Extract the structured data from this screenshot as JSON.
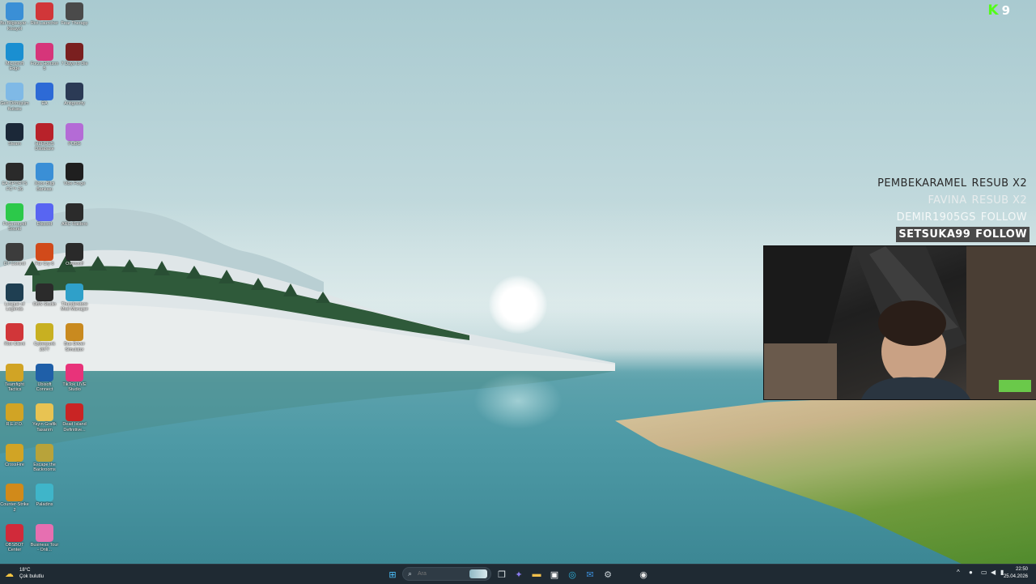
{
  "desktop_icons": [
    {
      "label": "Bu Bilgisayar - Kısayol",
      "icon": "computer-icon",
      "color": "#3a8fd6"
    },
    {
      "label": "Riot Launcher",
      "icon": "riot-icon",
      "color": "#d13639"
    },
    {
      "label": "Fear Therapy",
      "icon": "game-icon",
      "color": "#4a4a4a"
    },
    {
      "label": "Microsoft Edge",
      "icon": "edge-icon",
      "color": "#1a8fd1"
    },
    {
      "label": "Forza Horizon 5",
      "icon": "forza-icon",
      "color": "#d6357a"
    },
    {
      "label": "7 Days to Die",
      "icon": "game-icon",
      "color": "#7a1f1f"
    },
    {
      "label": "Geri Dönüşüm Kutusu",
      "icon": "recycle-bin-icon",
      "color": "#7fb9e6"
    },
    {
      "label": "EA",
      "icon": "ea-icon",
      "color": "#2d6ad6"
    },
    {
      "label": "Antigravity",
      "icon": "antigravity-icon",
      "color": "#2b3a55"
    },
    {
      "label": "Steam",
      "icon": "steam-icon",
      "color": "#1b2838"
    },
    {
      "label": "HEROES Database",
      "icon": "game-icon",
      "color": "#b8222a"
    },
    {
      "label": "PUBG",
      "icon": "pubg-icon",
      "color": "#b46bd6"
    },
    {
      "label": "EA SPORTS FC™ 26",
      "icon": "game-icon",
      "color": "#2a2a2a"
    },
    {
      "label": "Xbox Bilgi Bankası",
      "icon": "globe-icon",
      "color": "#3a8fd6"
    },
    {
      "label": "Vibe Forge",
      "icon": "forge-icon",
      "color": "#1f1f1f"
    },
    {
      "label": "FxSurround Sound",
      "icon": "sound-icon",
      "color": "#2cc94a"
    },
    {
      "label": "Discord",
      "icon": "discord-icon",
      "color": "#5865f2"
    },
    {
      "label": "ARC Raiders",
      "icon": "game-icon",
      "color": "#2b2b2b"
    },
    {
      "label": "DT Control",
      "icon": "control-icon",
      "color": "#3c3c3c"
    },
    {
      "label": "Far Cry 6",
      "icon": "farcry-icon",
      "color": "#d14a1a"
    },
    {
      "label": "Overwolf",
      "icon": "overwolf-icon",
      "color": "#2a2a2a"
    },
    {
      "label": "League of Legends",
      "icon": "lol-icon",
      "color": "#1f3f52"
    },
    {
      "label": "OBS Studio",
      "icon": "obs-icon",
      "color": "#2b2b2b"
    },
    {
      "label": "Thunderstore Mod Manager",
      "icon": "mod-icon",
      "color": "#2fa0c9"
    },
    {
      "label": "Riot Client",
      "icon": "riot-icon",
      "color": "#d13639"
    },
    {
      "label": "Cyberpunk 2077",
      "icon": "game-icon",
      "color": "#c8b021"
    },
    {
      "label": "Bus Driver Simulator",
      "icon": "game-icon",
      "color": "#c98a1f"
    },
    {
      "label": "Teamfight Tactics",
      "icon": "tft-icon",
      "color": "#d1a425"
    },
    {
      "label": "Ubisoft Connect",
      "icon": "ubisoft-icon",
      "color": "#1f5fa8"
    },
    {
      "label": "TikTok LIVE Studio",
      "icon": "tiktok-icon",
      "color": "#e8337a"
    },
    {
      "label": "R.E.P.O.",
      "icon": "game-icon",
      "color": "#d1a425"
    },
    {
      "label": "Yayın Grafik Tasarım",
      "icon": "folder-icon",
      "color": "#e8c352"
    },
    {
      "label": "Dead Island Definitive...",
      "icon": "game-icon",
      "color": "#c92424"
    },
    {
      "label": "CrossFire",
      "icon": "crossfire-icon",
      "color": "#d1a425"
    },
    {
      "label": "Escape the Backrooms",
      "icon": "game-icon",
      "color": "#b8a33a"
    },
    {
      "label": "",
      "icon": "",
      "color": ""
    },
    {
      "label": "Counter-Strike 2",
      "icon": "cs2-icon",
      "color": "#d18a1a"
    },
    {
      "label": "Paladins",
      "icon": "paladins-icon",
      "color": "#3fb5c9"
    },
    {
      "label": "",
      "icon": "",
      "color": ""
    },
    {
      "label": "OBSBOT Center",
      "icon": "obsbot-icon",
      "color": "#d12a3a"
    },
    {
      "label": "Business Tour - Onli...",
      "icon": "game-icon",
      "color": "#e66fb1"
    },
    {
      "label": "",
      "icon": "",
      "color": ""
    }
  ],
  "stream_overlay": {
    "kick": {
      "glyph": "K",
      "count": "9",
      "brand_color": "#53fc18"
    },
    "events": [
      {
        "user": "PEMBEKARAMEL",
        "action": "RESUB X2",
        "text_color": "#2a2a2a",
        "bg": "transparent"
      },
      {
        "user": "FAVINA",
        "action": "RESUB X2",
        "text_color": "#e7eced",
        "bg": "transparent"
      },
      {
        "user": "DEMIR1905GS",
        "action": "FOLLOW",
        "text_color": "#f4f8f8",
        "bg": "transparent"
      },
      {
        "user": "SETSUKA99",
        "action": "FOLLOW",
        "text_color": "#ffffff",
        "bg": "#4a4a4a"
      }
    ]
  },
  "taskbar": {
    "weather": {
      "temp": "18°C",
      "desc": "Çok bulutlu"
    },
    "search_placeholder": "Ara",
    "pinned": [
      {
        "icon": "windows-start-icon",
        "glyph": "⊞",
        "color": "#4cc2ff"
      },
      {
        "icon": "task-view-icon",
        "glyph": "❐",
        "color": "#dfe6ea"
      },
      {
        "icon": "copilot-icon",
        "glyph": "✦",
        "color": "#8a7cf0"
      },
      {
        "icon": "file-explorer-icon",
        "glyph": "▬",
        "color": "#f2c04b"
      },
      {
        "icon": "store-icon",
        "glyph": "▣",
        "color": "#ffffff"
      },
      {
        "icon": "edge-icon",
        "glyph": "◎",
        "color": "#2fb4e0"
      },
      {
        "icon": "mail-icon",
        "glyph": "✉",
        "color": "#3b8ed8"
      },
      {
        "icon": "settings-icon",
        "glyph": "⚙",
        "color": "#c8d0d5"
      },
      {
        "icon": "obs-icon",
        "glyph": "◉",
        "color": "#e8e8e8"
      }
    ],
    "tray": {
      "chevron": "^",
      "mic": "🎙",
      "network": "▭",
      "volume": "🔊",
      "battery": "▮"
    },
    "clock": {
      "time": "22:50",
      "date": "25.04.2026"
    }
  }
}
